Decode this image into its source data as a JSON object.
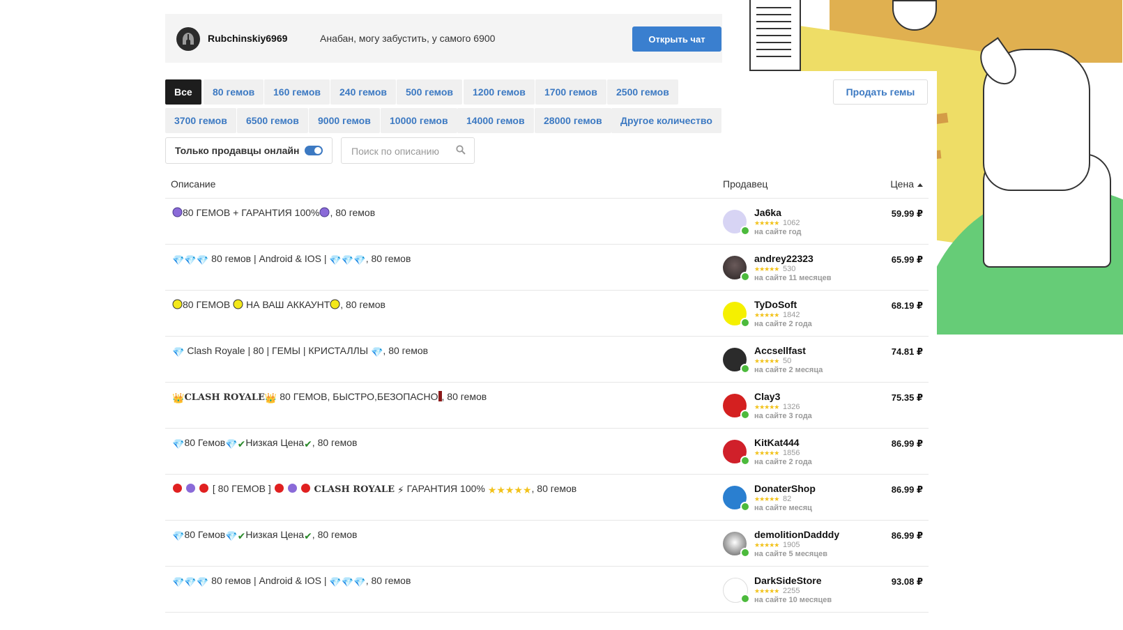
{
  "chat": {
    "username": "Rubchinskiy6969",
    "message": "Анабан, могу забустить, у самого 6900",
    "open_chat_label": "Открыть чат"
  },
  "filters": {
    "chips_row1": [
      "Все",
      "80 гемов",
      "160 гемов",
      "240 гемов",
      "500 гемов",
      "1200 гемов",
      "1700 гемов",
      "2500 гемов"
    ],
    "chips_row2": [
      "3700 гемов",
      "6500 гемов",
      "9000 гемов",
      "10000 гемов",
      "14000 гемов",
      "28000 гемов",
      "Другое количество"
    ],
    "active_chip": "Все",
    "sell_label": "Продать гемы",
    "online_only_label": "Только продавцы онлайн",
    "online_only_enabled": true,
    "search_placeholder": "Поиск по описанию"
  },
  "table": {
    "headers": {
      "description": "Описание",
      "seller": "Продавец",
      "price": "Цена"
    },
    "rows": [
      {
        "desc_text": "80 ГЕМОВ + ГАРАНТИЯ 100%",
        "desc_suffix": ", 80 гемов",
        "seller": "Ja6ka",
        "reviews": "1062",
        "since": "на сайте год",
        "price": "59.99 ₽",
        "avatar_color": "#c9c6f0"
      },
      {
        "desc_text": " 80 гемов | Android & IOS | ",
        "desc_suffix": ", 80 гемов",
        "seller": "andrey22323",
        "reviews": "530",
        "since": "на сайте 11 месяцев",
        "price": "65.99 ₽",
        "avatar_color": "#4a4040"
      },
      {
        "desc_text": "80 ГЕМОВ ",
        "desc_text2": " НА ВАШ АККАУНТ",
        "desc_suffix": ", 80 гемов",
        "seller": "TyDoSoft",
        "reviews": "1842",
        "since": "на сайте 2 года",
        "price": "68.19 ₽",
        "avatar_color": "#f5f000"
      },
      {
        "desc_text": " Clash Royale | 80 | ГЕМЫ | КРИСТАЛЛЫ ",
        "desc_suffix": ", 80 гемов",
        "seller": "Accsellfast",
        "reviews": "50",
        "since": "на сайте 2 месяца",
        "price": "74.81 ₽",
        "avatar_color": "#2b2b2b"
      },
      {
        "desc_bold": "CLASH ROYALE",
        "desc_text": " 80 ГЕМОВ, БЫСТРО,БЕЗОПАСНО",
        "desc_suffix": ", 80 гемов",
        "seller": "Clay3",
        "reviews": "1326",
        "since": "на сайте 3 года",
        "price": "75.35 ₽",
        "avatar_color": "#d42020"
      },
      {
        "desc_text": "80 Гемов",
        "desc_text2": "Низкая Цена",
        "desc_suffix": ", 80 гемов",
        "seller": "KitKat444",
        "reviews": "1856",
        "since": "на сайте 2 года",
        "price": "86.99 ₽",
        "avatar_color": "#d0202a"
      },
      {
        "desc_text": " [ 80 ГЕМОВ ] ",
        "desc_bold": "CLASH ROYALE",
        "desc_text2": " ГАРАНТИЯ 100% ",
        "desc_suffix": ", 80 гемов",
        "seller": "DonaterShop",
        "reviews": "82",
        "since": "на сайте месяц",
        "price": "86.99 ₽",
        "avatar_color": "#2a7fd0"
      },
      {
        "desc_text": "80 Гемов",
        "desc_text2": "Низкая Цена",
        "desc_suffix": ", 80 гемов",
        "seller": "demolitionDadddy",
        "reviews": "1905",
        "since": "на сайте 5 месяцев",
        "price": "86.99 ₽",
        "avatar_color": "#e8e8e8"
      },
      {
        "desc_text": " 80 гемов | Android & IOS | ",
        "desc_suffix": ", 80 гемов",
        "seller": "DarkSideStore",
        "reviews": "2255",
        "since": "на сайте 10 месяцев",
        "price": "93.08 ₽",
        "avatar_color": "#ffffff"
      }
    ]
  },
  "colors": {
    "accent": "#3a7fcf",
    "online": "#4cba3c",
    "star": "#f2c21a"
  }
}
